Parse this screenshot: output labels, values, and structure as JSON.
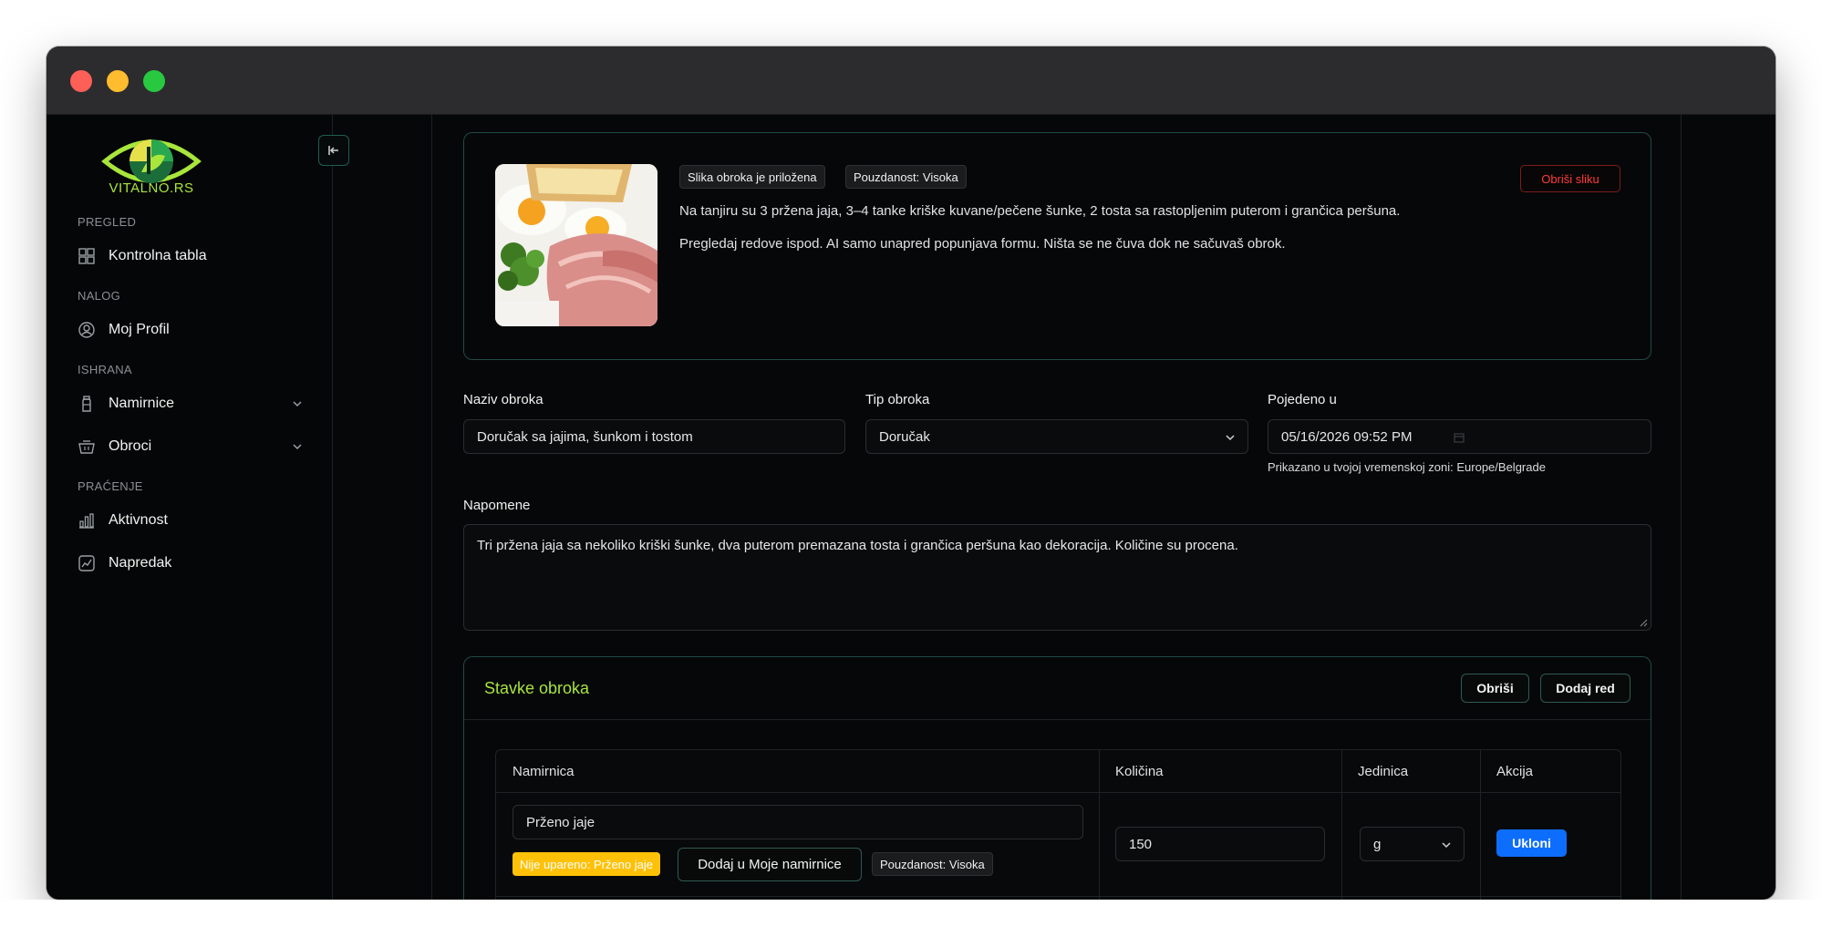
{
  "brand": {
    "name": "VITALNO.RS",
    "accent": "#a8e63c"
  },
  "sidebar": {
    "collapse_icon": "collapse-left-icon",
    "sections": [
      {
        "label": "PREGLED",
        "items": [
          {
            "label": "Kontrolna tabla",
            "icon": "dashboard-icon"
          }
        ]
      },
      {
        "label": "NALOG",
        "items": [
          {
            "label": "Moj Profil",
            "icon": "user-icon"
          }
        ]
      },
      {
        "label": "ISHRANA",
        "items": [
          {
            "label": "Namirnice",
            "icon": "bottle-icon",
            "expandable": true
          },
          {
            "label": "Obroci",
            "icon": "basket-icon",
            "expandable": true
          }
        ]
      },
      {
        "label": "PRAĆENJE",
        "items": [
          {
            "label": "Aktivnost",
            "icon": "bar-chart-icon"
          },
          {
            "label": "Napredak",
            "icon": "progress-icon"
          }
        ]
      }
    ]
  },
  "image_card": {
    "badges": [
      "Slika obroka je priložena",
      "Pouzdanost: Visoka"
    ],
    "delete_label": "Obriši sliku",
    "description": "Na tanjiru su 3 pržena jaja, 3–4 tanke kriške kuvane/pečene šunke, 2 tosta sa rastopljenim puterom i grančica peršuna.",
    "note": "Pregledaj redove ispod. AI samo unapred popunjava formu. Ništa se ne čuva dok ne sačuvaš obrok."
  },
  "form": {
    "name_label": "Naziv obroka",
    "name_value": "Doručak sa jajima, šunkom i tostom",
    "type_label": "Tip obroka",
    "type_value": "Doručak",
    "eaten_label": "Pojedeno u",
    "eaten_value": "05/16/2026  09:52  PM",
    "timezone_hint": "Prikazano u tvojoj vremenskoj zoni: Europe/Belgrade",
    "notes_label": "Napomene",
    "notes_value": "Tri pržena jaja sa nekoliko kriški šunke, dva puterom premazana tosta i grančica peršuna kao dekoracija. Količine su procena."
  },
  "items": {
    "title": "Stavke obroka",
    "delete_label": "Obriši",
    "add_row_label": "Dodaj red",
    "columns": [
      "Namirnica",
      "Količina",
      "Jedinica",
      "Akcija"
    ],
    "rows": [
      {
        "food": "Prženo jaje",
        "match_badge": "Nije upareno: Prženo jaje",
        "add_button": "Dodaj u Moje namirnice",
        "confidence": "Pouzdanost: Visoka",
        "quantity": "150",
        "unit": "g",
        "remove_label": "Ukloni"
      }
    ]
  }
}
